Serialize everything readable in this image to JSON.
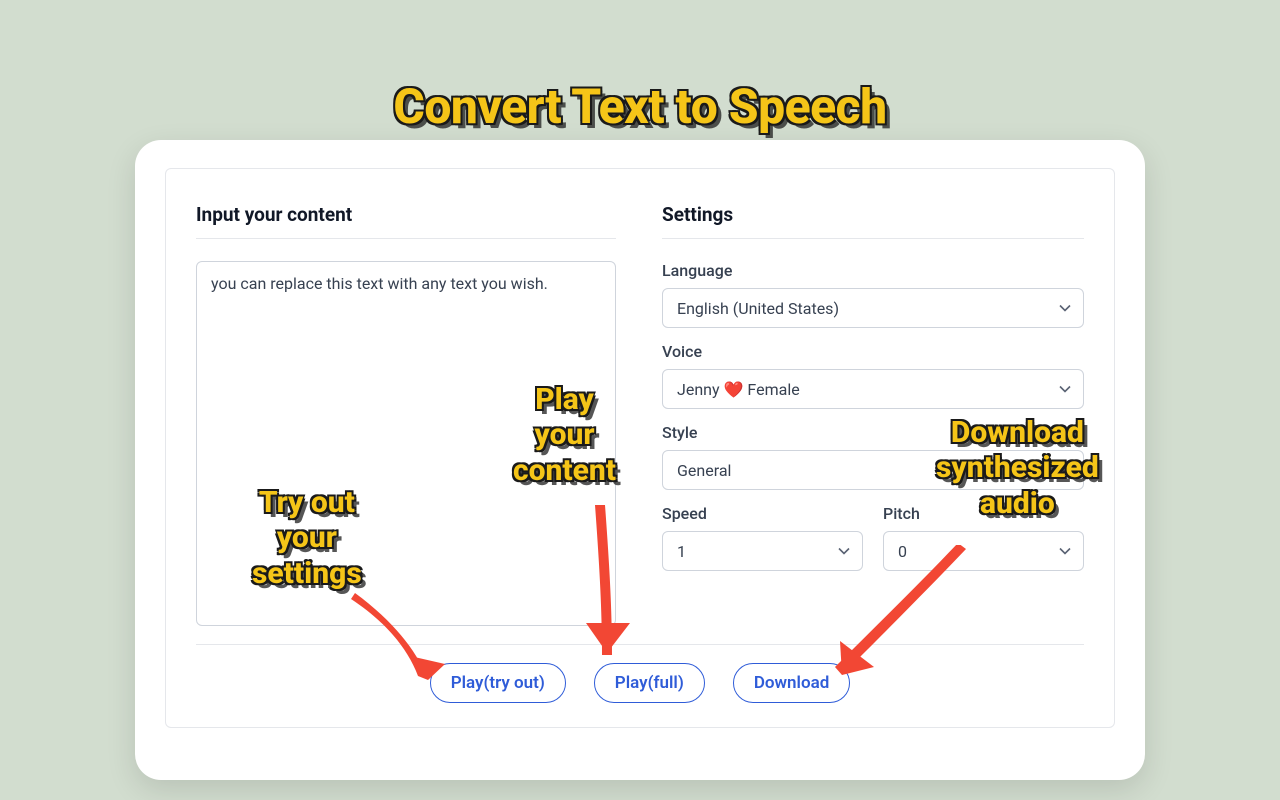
{
  "page_title": "Convert Text to Speech",
  "annotations": {
    "try_out": "Try out\nyour\nsettings",
    "play_content": "Play\nyour\ncontent",
    "download_audio": "Download\nsynthesized\naudio"
  },
  "left": {
    "heading": "Input your content",
    "content_value": "you can replace this text with any text you wish."
  },
  "right": {
    "heading": "Settings",
    "language_label": "Language",
    "language_value": "English (United States)",
    "voice_label": "Voice",
    "voice_value": "Jenny ❤️ Female",
    "style_label": "Style",
    "style_value": "General",
    "speed_label": "Speed",
    "speed_value": "1",
    "pitch_label": "Pitch",
    "pitch_value": "0"
  },
  "buttons": {
    "play_try": "Play(try out)",
    "play_full": "Play(full)",
    "download": "Download"
  }
}
